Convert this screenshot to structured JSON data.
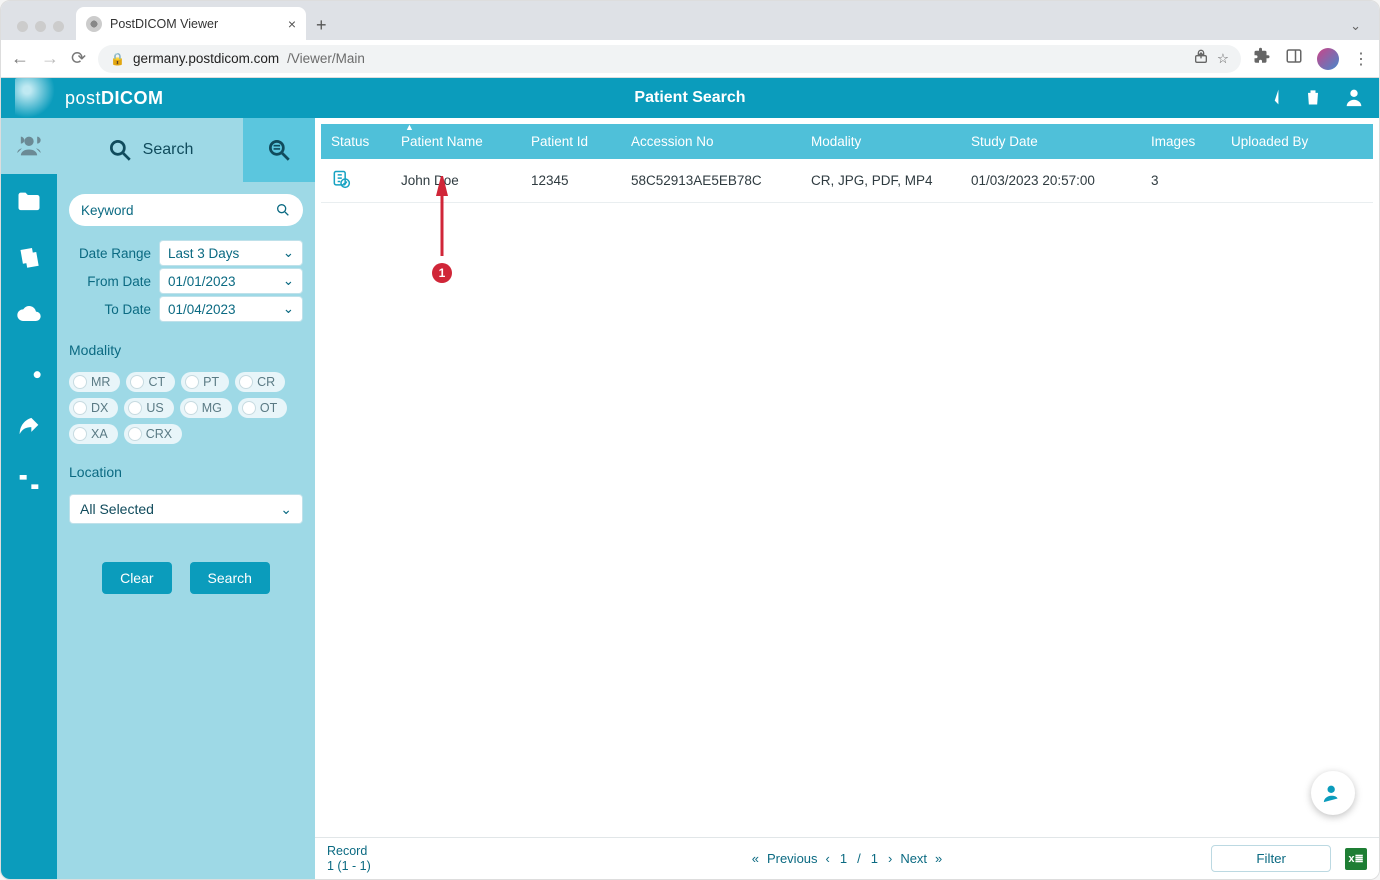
{
  "browser": {
    "tab_title": "PostDICOM Viewer",
    "url_host": "germany.postdicom.com",
    "url_path": "/Viewer/Main"
  },
  "header": {
    "logo_pre": "post",
    "logo_post": "DICOM",
    "title": "Patient Search"
  },
  "sidebar": {
    "tab_label": "Search",
    "keyword_placeholder": "Keyword",
    "date_range_label": "Date Range",
    "date_range_value": "Last 3 Days",
    "from_date_label": "From Date",
    "from_date_value": "01/01/2023",
    "to_date_label": "To Date",
    "to_date_value": "01/04/2023",
    "modality_label": "Modality",
    "modalities": [
      "MR",
      "CT",
      "PT",
      "CR",
      "DX",
      "US",
      "MG",
      "OT",
      "XA",
      "CRX"
    ],
    "location_label": "Location",
    "location_value": "All Selected",
    "clear_label": "Clear",
    "search_label": "Search"
  },
  "table": {
    "columns": [
      "Status",
      "Patient Name",
      "Patient Id",
      "Accession No",
      "Modality",
      "Study Date",
      "Images",
      "Uploaded By"
    ],
    "rows": [
      {
        "patient_name": "John Doe",
        "patient_id": "12345",
        "accession_no": "58C52913AE5EB78C",
        "modality": "CR, JPG, PDF, MP4",
        "study_date": "01/03/2023 20:57:00",
        "images": "3",
        "uploaded_by": ""
      }
    ]
  },
  "annotation": {
    "badge": "1"
  },
  "footer": {
    "record_label": "Record",
    "record_range": "1 (1 - 1)",
    "prev": "Previous",
    "page_current": "1",
    "page_sep": "/",
    "page_total": "1",
    "next": "Next",
    "filter": "Filter"
  }
}
